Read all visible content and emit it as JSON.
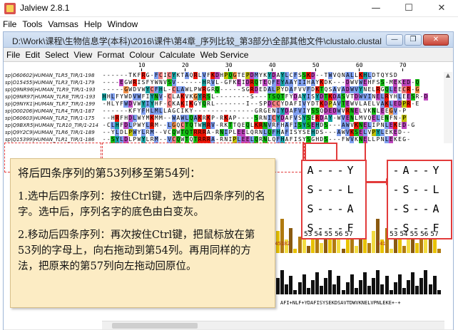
{
  "app": {
    "title": "Jalview 2.8.1",
    "minimize": "—",
    "maximize": "☐",
    "close": "✕"
  },
  "menubar": [
    "File",
    "Tools",
    "Vamsas",
    "Help",
    "Window"
  ],
  "inner_window": {
    "path": "D:\\Work\\课程\\生物信息学(本科)\\2016\\课件\\第4章_序列比较_第3部分\\全部其他文件\\clustalo.clustal",
    "menu": [
      "File",
      "Edit",
      "Select",
      "View",
      "Format",
      "Colour",
      "Calculate",
      "Web Service"
    ]
  },
  "ruler": {
    "labels": [
      "10",
      "20",
      "30",
      "40",
      "50",
      "60",
      "70"
    ]
  },
  "sequences": [
    {
      "name": "sp|O60602|HUMAN_TLR5_TIR/1-198",
      "seq": "------TKFRG-FCICYKTAQRLVFKDHPQGTEPDMYKYDAYLCFSSKD--TWVQNALLKHLDTQYSD"
    },
    {
      "name": "sp|O15455|HUMAN_TLR3_TIR/1-179",
      "seq": "----EGWRISFYWNVSV------HRVL-GFKEIDRQTEQFEYAAYIIHAYKDK---DWVWEHFSS-MEKED-Q"
    },
    {
      "name": "sp|Q9NR96|HUMAN_TLR9_TIR/1-193",
      "seq": "-----GWDVWYCFHL-CLAWLPWRGRQ-----SGRDEDALPYDAFVVFDKTQSAVADWVYNELRGQLEECR-G"
    },
    {
      "name": "sp|Q9NR97|HUMAN_TLR8_TIR/1-193",
      "seq": "HHLFYWDVWFIYNV-CLAKVKGYRSL--------S---TSQTFYDAYISYDTKDASVTDWVINELRYHLEESR-D"
    },
    {
      "name": "sp|Q9NYK1|HUMAN_TLR7_TIR/1-199",
      "seq": "-HLYFWDVWYIYHF-CKAKIKGYQRL-------I--SPDCCYDAFIVYDTKDPAVTEWVLAELVAKLEDPR-E"
    },
    {
      "name": "sp|O00206|HUMAN_TLR4_TIR/1-187",
      "seq": "------KFYFHLMLLAGCIKY--------------GRGENIYDAFVIYSSQDEDWVRNELVKNLEEGV-P"
    },
    {
      "name": "sp|O60603|HUMAN_TLR2_TIR/1-175",
      "seq": "--HRFHDLWYMKMM--WAWLQAKRKP-RKAP----SRNICYDAFVSYSERDAY-WVENLMVQELENFN-P"
    },
    {
      "name": "sp|Q9BXR5|HUMAN_TLR10_TIR/1-214",
      "seq": "-CLHFDLPWYLRM--LGQCTQTWHRV-RKTTQEQLKRNVRFHAFISYSEHDS---AWVKNELIPNLEKED-G"
    },
    {
      "name": "sp|Q9Y2C9|HUMAN_TLR6_TIR/1-189",
      "seq": "--YLDLPWYLRM--VCQWTQTRRRA-RNIPLEELQRNLQFHAFISYSEHDS---AWVKSELVPYLEKED--"
    },
    {
      "name": "sp|Q15399|HUMAN_TLR1_TIR/1-186",
      "seq": "--SYLDLPWYLRM--VCQWTQTRRRA-RNIPLEELQRNLQFHAFISYSGHDS---FWVKNELLPNLEKEG-"
    }
  ],
  "note": {
    "heading": "将后四条序列的第53列移至第54列：",
    "step1": "1.选中后四条序列：按住Ctrl键，选中后四条序列的名字。选中后，序列名字的底色由白变灰。",
    "step2": "2.移动后四条序列：再次按住Ctrl键，把鼠标放在第53列的字母上，向右拖动到第54列。再用同样的方法，把原来的第57列向左拖动回原位。"
  },
  "zoom_before": {
    "rows": [
      [
        "A",
        "-",
        "-",
        "-",
        "Y"
      ],
      [
        "S",
        "-",
        "-",
        "-",
        "L"
      ],
      [
        "S",
        "-",
        "-",
        "-",
        "A"
      ],
      [
        "S",
        "-",
        "-",
        "-",
        "F"
      ]
    ],
    "cols": "53 54 55 56 57"
  },
  "zoom_after": {
    "rows": [
      [
        "-",
        "A",
        "-",
        "-",
        "Y"
      ],
      [
        "-",
        "S",
        "-",
        "-",
        "L"
      ],
      [
        "-",
        "S",
        "-",
        "-",
        "A"
      ],
      [
        "-",
        "S",
        "-",
        "-",
        "F"
      ]
    ],
    "cols": "53 54 55 56 57"
  },
  "annotation": {
    "consensus": "AFI+NLF+YDAFISYSEKDSAVTDWVKNELVPNLEKE+-+",
    "digits_left": "2245182",
    "digits_right": "341"
  },
  "colors": {
    "accent_red": "#e23b3b",
    "note_bg": "#fcecc4"
  }
}
